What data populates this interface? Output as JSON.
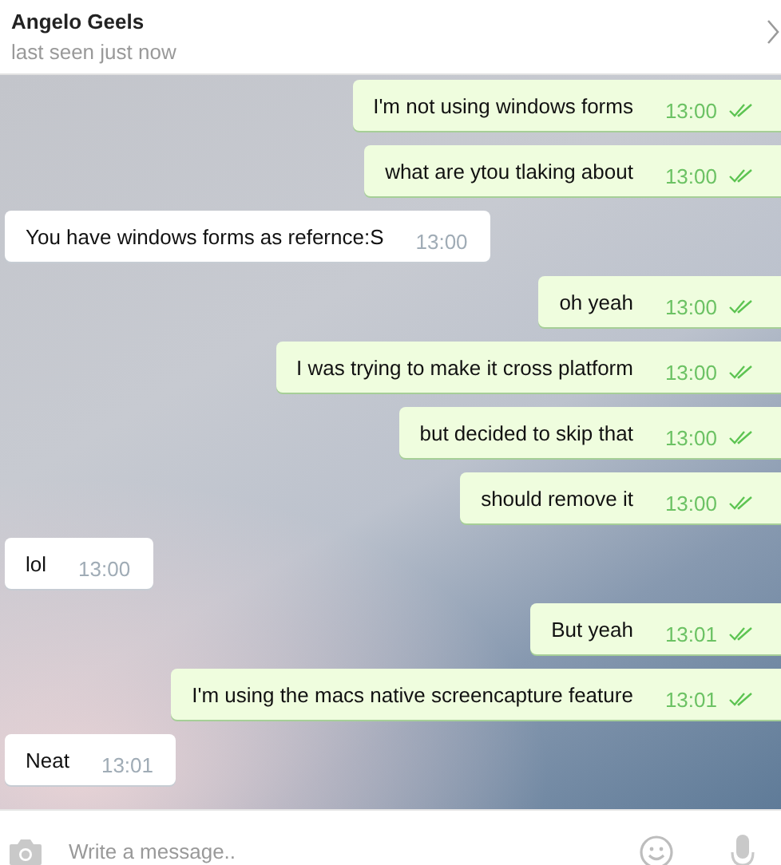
{
  "header": {
    "name": "Angelo Geels",
    "status": "last seen just now"
  },
  "messages": [
    {
      "kind": "outgoing",
      "text": "I'm not using windows forms",
      "time": "13:00",
      "read": true
    },
    {
      "kind": "outgoing",
      "text": "what are ytou tlaking about",
      "time": "13:00",
      "read": true
    },
    {
      "kind": "incoming",
      "text": "You have windows forms as refernce:S",
      "time": "13:00"
    },
    {
      "kind": "outgoing",
      "text": "oh yeah",
      "time": "13:00",
      "read": true
    },
    {
      "kind": "outgoing",
      "text": "I was trying to make it cross platform",
      "time": "13:00",
      "read": true
    },
    {
      "kind": "outgoing",
      "text": "but decided to skip that",
      "time": "13:00",
      "read": true
    },
    {
      "kind": "outgoing",
      "text": "should remove it",
      "time": "13:00",
      "read": true
    },
    {
      "kind": "incoming",
      "text": "lol",
      "time": "13:00"
    },
    {
      "kind": "outgoing",
      "text": "But yeah",
      "time": "13:01",
      "read": true
    },
    {
      "kind": "outgoing",
      "text": "I'm using the macs native screencapture feature",
      "time": "13:01",
      "read": true
    },
    {
      "kind": "incoming",
      "text": "Neat",
      "time": "13:01"
    }
  ],
  "composer": {
    "placeholder": "Write a message.."
  }
}
